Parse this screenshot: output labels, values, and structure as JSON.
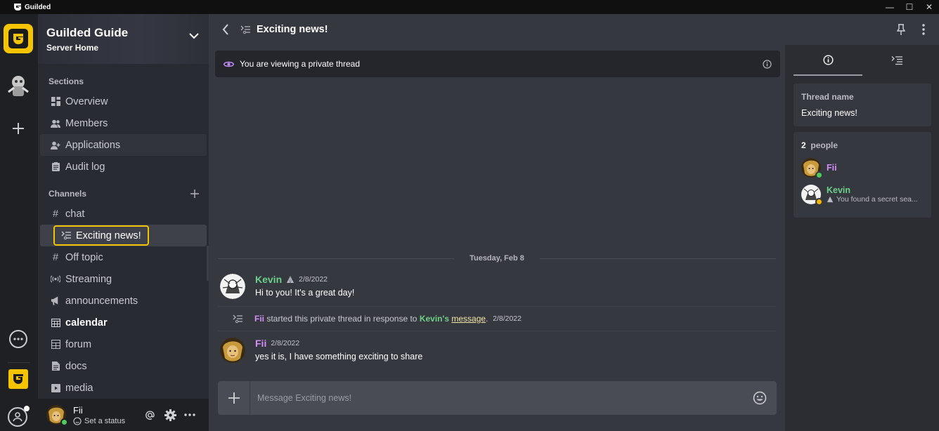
{
  "app": {
    "title": "Guilded"
  },
  "server": {
    "name": "Guilded Guide",
    "subtitle": "Server Home"
  },
  "sidebar": {
    "sections_title": "Sections",
    "sections": [
      {
        "label": "Overview"
      },
      {
        "label": "Members"
      },
      {
        "label": "Applications"
      },
      {
        "label": "Audit log"
      }
    ],
    "channels_title": "Channels",
    "channels": [
      {
        "label": "chat"
      },
      {
        "label": "Exciting news!"
      },
      {
        "label": "Off topic"
      },
      {
        "label": "Streaming"
      },
      {
        "label": "announcements"
      },
      {
        "label": "calendar"
      },
      {
        "label": "forum"
      },
      {
        "label": "docs"
      },
      {
        "label": "media"
      }
    ]
  },
  "user": {
    "name": "Fii",
    "status": "Set a status"
  },
  "thread": {
    "title": "Exciting news!",
    "banner": "You are viewing a private thread",
    "date_divider": "Tuesday, Feb 8",
    "messages": [
      {
        "author": "Kevin",
        "time": "2/8/2022",
        "text": "Hi to you! It's a great day!",
        "color": "#6dd089"
      },
      {
        "author": "Fii",
        "time": "2/8/2022",
        "text": "yes it is, I have something exciting to share",
        "color": "#d38ef9"
      }
    ],
    "system": {
      "starter": "Fii",
      "part1": "started this private thread in response to",
      "ref_author": "Kevin's",
      "ref_link": "message",
      "suffix": ".",
      "time": "2/8/2022"
    },
    "composer_placeholder": "Message Exciting news!"
  },
  "details": {
    "name_label": "Thread name",
    "name_value": "Exciting news!",
    "people_count": "2",
    "people_label": "people",
    "members": [
      {
        "name": "Fii",
        "status": "",
        "color": "#d38ef9",
        "presence": "#4ecb5d"
      },
      {
        "name": "Kevin",
        "status": "You found a secret sea...",
        "color": "#6dd089",
        "presence": "#f5b400"
      }
    ]
  },
  "colors": {
    "accent": "#f5c400",
    "green": "#6dd089",
    "purple": "#d38ef9",
    "link": "#f3e8a8"
  }
}
